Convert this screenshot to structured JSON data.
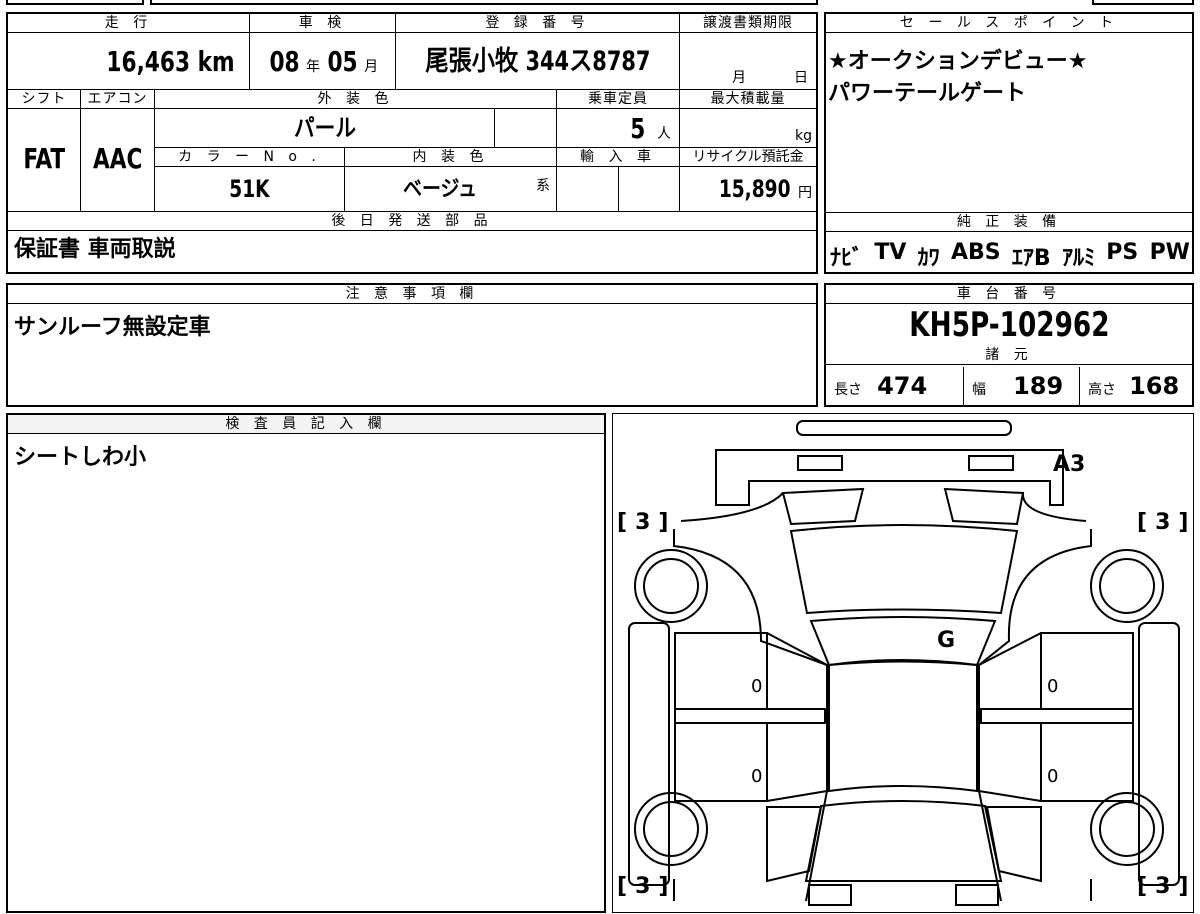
{
  "headers": {
    "mileage": "走 行",
    "inspection": "車 検",
    "registration": "登 録 番 号",
    "transfer_deadline": "譲渡書類期限",
    "sales_point": "セ ー ル ス ポ イ ン ト",
    "shift": "シフト",
    "aircon": "エアコン",
    "exterior_color": "外 装 色",
    "capacity": "乗車定員",
    "max_load": "最大積載量",
    "color_no": "カ ラ ー N o .",
    "interior_color": "内 装 色",
    "import": "輸 入 車",
    "recycle": "リサイクル預託金",
    "later_parts": "後 日 発 送 部 品",
    "genuine_equipment": "純 正 装 備",
    "notes": "注 意 事 項 欄",
    "chassis_no": "車 台 番 号",
    "specs": "諸 元",
    "inspector": "検 査 員 記 入 欄"
  },
  "vehicle": {
    "mileage": "16,463",
    "mileage_unit": "km",
    "inspection_year": "08",
    "year_unit": "年",
    "inspection_month": "05",
    "month_unit": "月",
    "registration_number": "尾張小牧 344ス8787",
    "deadline_month_unit": "月",
    "deadline_day_unit": "日",
    "shift": "FAT",
    "aircon": "AAC",
    "exterior_color": "パール",
    "capacity": "5",
    "capacity_unit": "人",
    "max_load_unit": "kg",
    "color_no": "51K",
    "interior_color": "ベージュ",
    "interior_suffix": "系",
    "recycle_fee": "15,890",
    "recycle_unit": "円",
    "later_parts": "保証書 車両取説",
    "chassis_number": "KH5P-102962"
  },
  "sales_points": [
    "★オークションデビュー★",
    "パワーテールゲート"
  ],
  "equipment": [
    "ﾅﾋﾞ",
    "TV",
    "ｶﾜ",
    "ABS",
    "ｴｱB",
    "ｱﾙﾐ",
    "PS",
    "PW"
  ],
  "notes": "サンルーフ無設定車",
  "specs": {
    "length_label": "長さ",
    "length": "474",
    "width_label": "幅",
    "width": "189",
    "height_label": "高さ",
    "height": "168"
  },
  "inspector_comment": "シートしわ小",
  "diagram": {
    "marks": {
      "rear_bumper": "A3",
      "hood": "G",
      "left_front_door": "0",
      "right_front_door": "0",
      "left_rear_door": "0",
      "right_rear_door": "0"
    },
    "tire_front_left": "3",
    "tire_front_right": "3",
    "tire_rear_left": "3",
    "tire_rear_right": "3",
    "bracket_open": "[",
    "bracket_close": "]"
  }
}
